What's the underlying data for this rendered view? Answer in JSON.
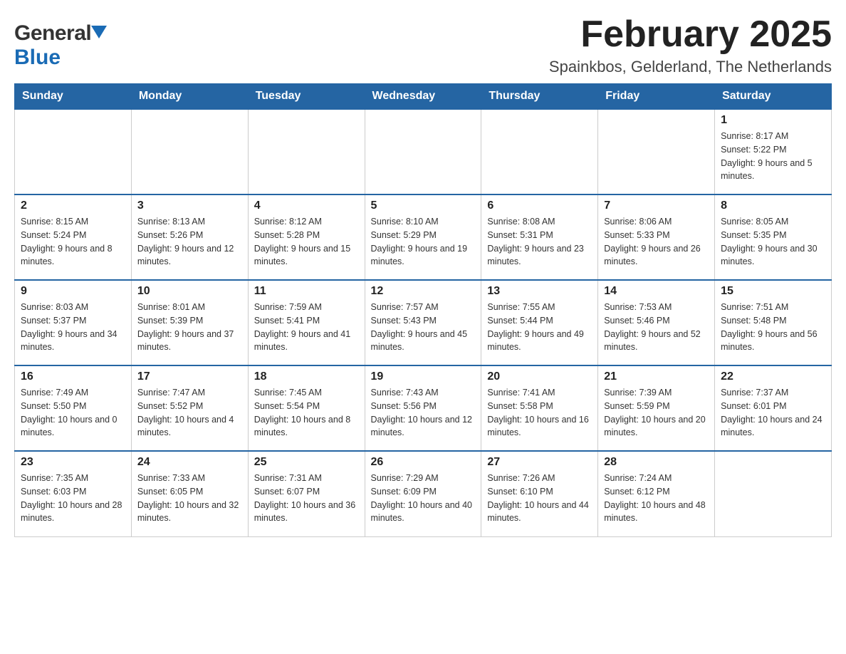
{
  "header": {
    "logo_general": "General",
    "logo_blue": "Blue",
    "month_title": "February 2025",
    "location": "Spainkbos, Gelderland, The Netherlands"
  },
  "days_of_week": [
    "Sunday",
    "Monday",
    "Tuesday",
    "Wednesday",
    "Thursday",
    "Friday",
    "Saturday"
  ],
  "weeks": [
    {
      "days": [
        {
          "number": "",
          "info": ""
        },
        {
          "number": "",
          "info": ""
        },
        {
          "number": "",
          "info": ""
        },
        {
          "number": "",
          "info": ""
        },
        {
          "number": "",
          "info": ""
        },
        {
          "number": "",
          "info": ""
        },
        {
          "number": "1",
          "info": "Sunrise: 8:17 AM\nSunset: 5:22 PM\nDaylight: 9 hours and 5 minutes."
        }
      ]
    },
    {
      "days": [
        {
          "number": "2",
          "info": "Sunrise: 8:15 AM\nSunset: 5:24 PM\nDaylight: 9 hours and 8 minutes."
        },
        {
          "number": "3",
          "info": "Sunrise: 8:13 AM\nSunset: 5:26 PM\nDaylight: 9 hours and 12 minutes."
        },
        {
          "number": "4",
          "info": "Sunrise: 8:12 AM\nSunset: 5:28 PM\nDaylight: 9 hours and 15 minutes."
        },
        {
          "number": "5",
          "info": "Sunrise: 8:10 AM\nSunset: 5:29 PM\nDaylight: 9 hours and 19 minutes."
        },
        {
          "number": "6",
          "info": "Sunrise: 8:08 AM\nSunset: 5:31 PM\nDaylight: 9 hours and 23 minutes."
        },
        {
          "number": "7",
          "info": "Sunrise: 8:06 AM\nSunset: 5:33 PM\nDaylight: 9 hours and 26 minutes."
        },
        {
          "number": "8",
          "info": "Sunrise: 8:05 AM\nSunset: 5:35 PM\nDaylight: 9 hours and 30 minutes."
        }
      ]
    },
    {
      "days": [
        {
          "number": "9",
          "info": "Sunrise: 8:03 AM\nSunset: 5:37 PM\nDaylight: 9 hours and 34 minutes."
        },
        {
          "number": "10",
          "info": "Sunrise: 8:01 AM\nSunset: 5:39 PM\nDaylight: 9 hours and 37 minutes."
        },
        {
          "number": "11",
          "info": "Sunrise: 7:59 AM\nSunset: 5:41 PM\nDaylight: 9 hours and 41 minutes."
        },
        {
          "number": "12",
          "info": "Sunrise: 7:57 AM\nSunset: 5:43 PM\nDaylight: 9 hours and 45 minutes."
        },
        {
          "number": "13",
          "info": "Sunrise: 7:55 AM\nSunset: 5:44 PM\nDaylight: 9 hours and 49 minutes."
        },
        {
          "number": "14",
          "info": "Sunrise: 7:53 AM\nSunset: 5:46 PM\nDaylight: 9 hours and 52 minutes."
        },
        {
          "number": "15",
          "info": "Sunrise: 7:51 AM\nSunset: 5:48 PM\nDaylight: 9 hours and 56 minutes."
        }
      ]
    },
    {
      "days": [
        {
          "number": "16",
          "info": "Sunrise: 7:49 AM\nSunset: 5:50 PM\nDaylight: 10 hours and 0 minutes."
        },
        {
          "number": "17",
          "info": "Sunrise: 7:47 AM\nSunset: 5:52 PM\nDaylight: 10 hours and 4 minutes."
        },
        {
          "number": "18",
          "info": "Sunrise: 7:45 AM\nSunset: 5:54 PM\nDaylight: 10 hours and 8 minutes."
        },
        {
          "number": "19",
          "info": "Sunrise: 7:43 AM\nSunset: 5:56 PM\nDaylight: 10 hours and 12 minutes."
        },
        {
          "number": "20",
          "info": "Sunrise: 7:41 AM\nSunset: 5:58 PM\nDaylight: 10 hours and 16 minutes."
        },
        {
          "number": "21",
          "info": "Sunrise: 7:39 AM\nSunset: 5:59 PM\nDaylight: 10 hours and 20 minutes."
        },
        {
          "number": "22",
          "info": "Sunrise: 7:37 AM\nSunset: 6:01 PM\nDaylight: 10 hours and 24 minutes."
        }
      ]
    },
    {
      "days": [
        {
          "number": "23",
          "info": "Sunrise: 7:35 AM\nSunset: 6:03 PM\nDaylight: 10 hours and 28 minutes."
        },
        {
          "number": "24",
          "info": "Sunrise: 7:33 AM\nSunset: 6:05 PM\nDaylight: 10 hours and 32 minutes."
        },
        {
          "number": "25",
          "info": "Sunrise: 7:31 AM\nSunset: 6:07 PM\nDaylight: 10 hours and 36 minutes."
        },
        {
          "number": "26",
          "info": "Sunrise: 7:29 AM\nSunset: 6:09 PM\nDaylight: 10 hours and 40 minutes."
        },
        {
          "number": "27",
          "info": "Sunrise: 7:26 AM\nSunset: 6:10 PM\nDaylight: 10 hours and 44 minutes."
        },
        {
          "number": "28",
          "info": "Sunrise: 7:24 AM\nSunset: 6:12 PM\nDaylight: 10 hours and 48 minutes."
        },
        {
          "number": "",
          "info": ""
        }
      ]
    }
  ]
}
